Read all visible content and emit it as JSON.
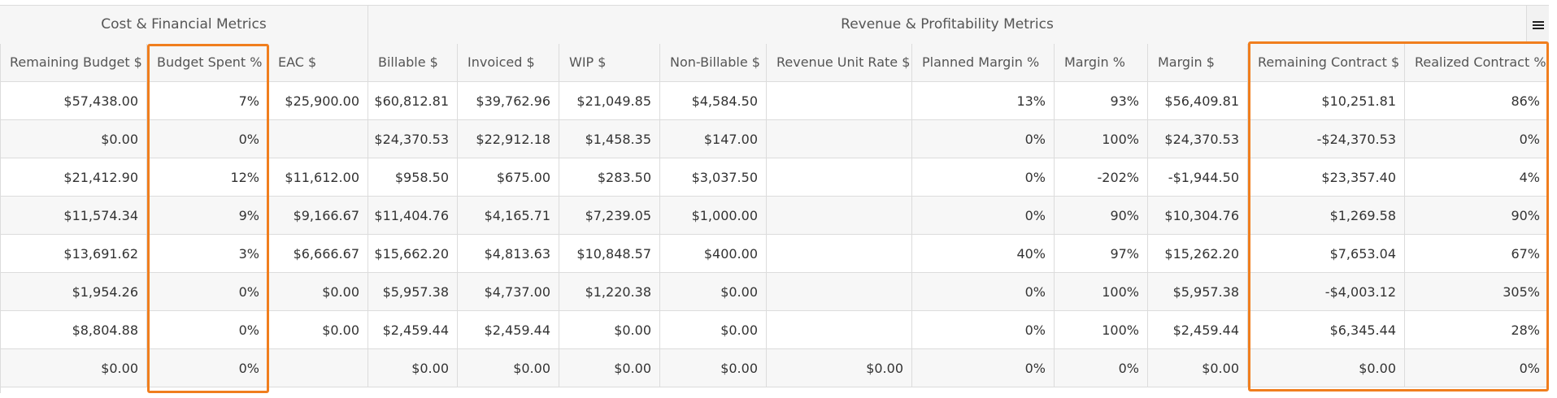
{
  "group_headers": {
    "cost": "Cost & Financial Metrics",
    "revenue": "Revenue & Profitability Metrics"
  },
  "columns": [
    "Remaining Budget $",
    "Budget Spent %",
    "EAC $",
    "Billable $",
    "Invoiced $",
    "WIP $",
    "Non-Billable $",
    "Revenue Unit Rate $",
    "Planned Margin %",
    "Margin %",
    "Margin $",
    "Remaining Contract $",
    "Realized Contract %"
  ],
  "rows": [
    [
      "$57,438.00",
      "7%",
      "$25,900.00",
      "$60,812.81",
      "$39,762.96",
      "$21,049.85",
      "$4,584.50",
      "",
      "13%",
      "93%",
      "$56,409.81",
      "$10,251.81",
      "86%"
    ],
    [
      "$0.00",
      "0%",
      "",
      "$24,370.53",
      "$22,912.18",
      "$1,458.35",
      "$147.00",
      "",
      "0%",
      "100%",
      "$24,370.53",
      "-$24,370.53",
      "0%"
    ],
    [
      "$21,412.90",
      "12%",
      "$11,612.00",
      "$958.50",
      "$675.00",
      "$283.50",
      "$3,037.50",
      "",
      "0%",
      "-202%",
      "-$1,944.50",
      "$23,357.40",
      "4%"
    ],
    [
      "$11,574.34",
      "9%",
      "$9,166.67",
      "$11,404.76",
      "$4,165.71",
      "$7,239.05",
      "$1,000.00",
      "",
      "0%",
      "90%",
      "$10,304.76",
      "$1,269.58",
      "90%"
    ],
    [
      "$13,691.62",
      "3%",
      "$6,666.67",
      "$15,662.20",
      "$4,813.63",
      "$10,848.57",
      "$400.00",
      "",
      "40%",
      "97%",
      "$15,262.20",
      "$7,653.04",
      "67%"
    ],
    [
      "$1,954.26",
      "0%",
      "$0.00",
      "$5,957.38",
      "$4,737.00",
      "$1,220.38",
      "$0.00",
      "",
      "0%",
      "100%",
      "$5,957.38",
      "-$4,003.12",
      "305%"
    ],
    [
      "$8,804.88",
      "0%",
      "$0.00",
      "$2,459.44",
      "$2,459.44",
      "$0.00",
      "$0.00",
      "",
      "0%",
      "100%",
      "$2,459.44",
      "$6,345.44",
      "28%"
    ],
    [
      "$0.00",
      "0%",
      "",
      "$0.00",
      "$0.00",
      "$0.00",
      "$0.00",
      "$0.00",
      "0%",
      "0%",
      "$0.00",
      "$0.00",
      "0%"
    ]
  ],
  "colors": {
    "highlight": "#f07e1e",
    "header_bg": "#f6f6f6",
    "alt_row_bg": "#f7f7f7",
    "border": "#dcdcdc"
  },
  "icons": {
    "menu": "hamburger-menu-icon"
  }
}
